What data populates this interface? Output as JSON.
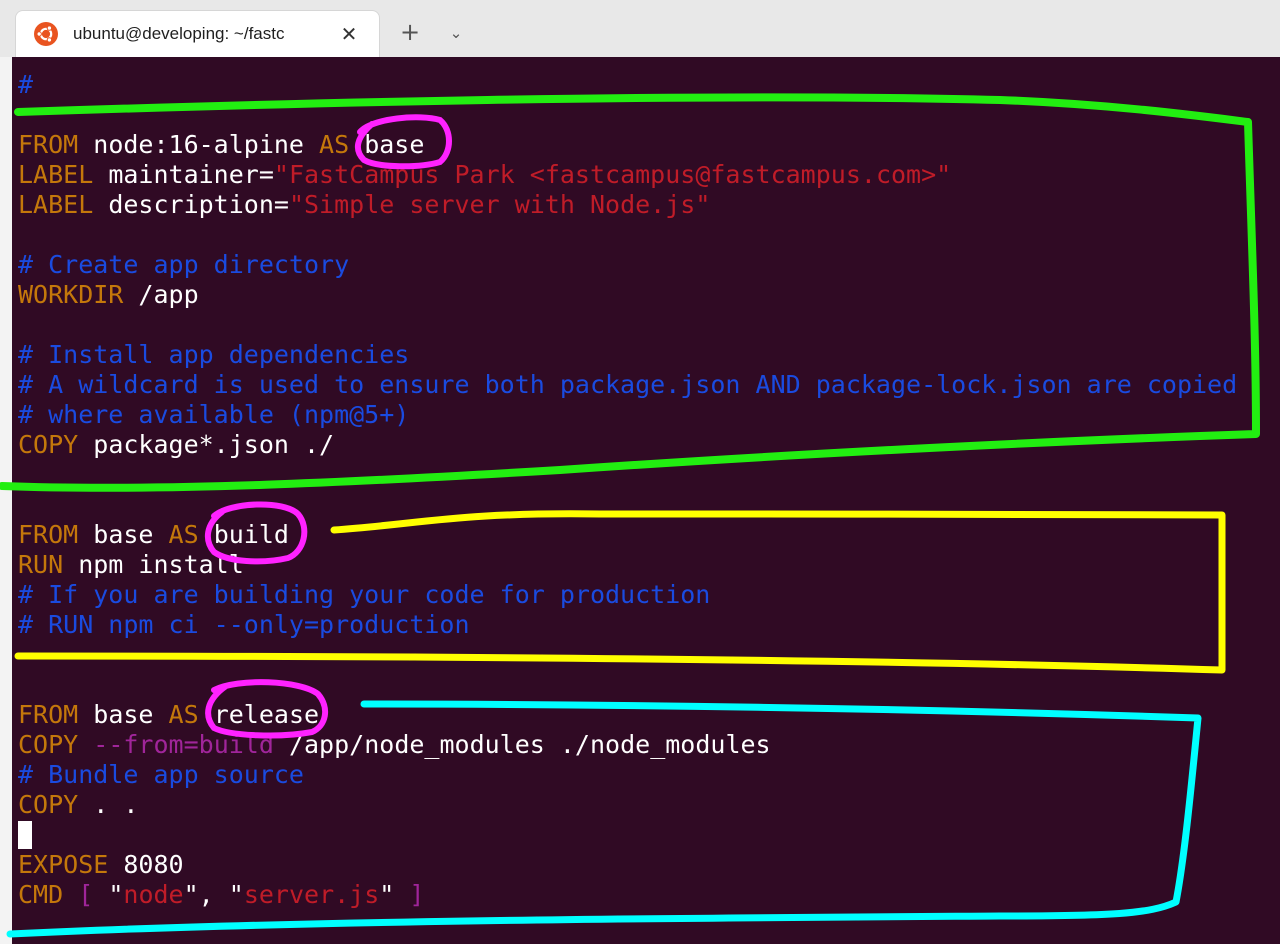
{
  "tab": {
    "title": "ubuntu@developing: ~/fastc",
    "icon": "ubuntu-logo-icon",
    "close_label": "✕",
    "new_tab_label": "+",
    "dropdown_label": "⌄"
  },
  "colors": {
    "terminal_bg": "#300a24",
    "keyword": "#c4780b",
    "string": "#c01c28",
    "comment": "#1a4be0",
    "operator": "#a0259a",
    "text": "#ffffff",
    "annotation_green": "#22ee11",
    "annotation_yellow": "#ffff00",
    "annotation_cyan": "#00ffff",
    "annotation_magenta": "#ff00ff"
  },
  "terminal": {
    "lines": [
      {
        "id": "l00",
        "parts": [
          [
            "cm",
            "#"
          ]
        ]
      },
      {
        "id": "l01",
        "parts": []
      },
      {
        "id": "l02",
        "parts": [
          [
            "kw",
            "FROM"
          ],
          [
            "tx",
            " node:16-alpine "
          ],
          [
            "kw",
            "AS"
          ],
          [
            "tx",
            " base"
          ]
        ]
      },
      {
        "id": "l03",
        "parts": [
          [
            "kw",
            "LABEL"
          ],
          [
            "tx",
            " maintainer="
          ],
          [
            "str",
            "\"FastCampus Park <fastcampus@fastcampus.com>\""
          ]
        ]
      },
      {
        "id": "l04",
        "parts": [
          [
            "kw",
            "LABEL"
          ],
          [
            "tx",
            " description="
          ],
          [
            "str",
            "\"Simple server with Node.js\""
          ]
        ]
      },
      {
        "id": "l05",
        "parts": []
      },
      {
        "id": "l06",
        "parts": [
          [
            "cm",
            "# Create app directory"
          ]
        ]
      },
      {
        "id": "l07",
        "parts": [
          [
            "kw",
            "WORKDIR"
          ],
          [
            "tx",
            " /app"
          ]
        ]
      },
      {
        "id": "l08",
        "parts": []
      },
      {
        "id": "l09",
        "parts": [
          [
            "cm",
            "# Install app dependencies"
          ]
        ]
      },
      {
        "id": "l10",
        "parts": [
          [
            "cm",
            "# A wildcard is used to ensure both package.json AND package-lock.json are copied"
          ]
        ]
      },
      {
        "id": "l11",
        "parts": [
          [
            "cm",
            "# where available (npm@5+)"
          ]
        ]
      },
      {
        "id": "l12",
        "parts": [
          [
            "kw",
            "COPY"
          ],
          [
            "tx",
            " package*.json ./"
          ]
        ]
      },
      {
        "id": "l13",
        "parts": []
      },
      {
        "id": "l14",
        "parts": []
      },
      {
        "id": "l15",
        "parts": [
          [
            "kw",
            "FROM"
          ],
          [
            "tx",
            " base "
          ],
          [
            "kw",
            "AS"
          ],
          [
            "tx",
            " build"
          ]
        ]
      },
      {
        "id": "l16",
        "parts": [
          [
            "kw",
            "RUN"
          ],
          [
            "tx",
            " npm install"
          ]
        ]
      },
      {
        "id": "l17",
        "parts": [
          [
            "cm",
            "# If you are building your code for production"
          ]
        ]
      },
      {
        "id": "l18",
        "parts": [
          [
            "cm",
            "# RUN npm ci --only=production"
          ]
        ]
      },
      {
        "id": "l19",
        "parts": []
      },
      {
        "id": "l20",
        "parts": []
      },
      {
        "id": "l21",
        "parts": [
          [
            "kw",
            "FROM"
          ],
          [
            "tx",
            " base "
          ],
          [
            "kw",
            "AS"
          ],
          [
            "tx",
            " release"
          ]
        ]
      },
      {
        "id": "l22",
        "parts": [
          [
            "kw",
            "COPY"
          ],
          [
            "tx",
            " "
          ],
          [
            "pu",
            "--from=build"
          ],
          [
            "tx",
            " /app/node_modules ./node_modules"
          ]
        ]
      },
      {
        "id": "l23",
        "parts": [
          [
            "cm",
            "# Bundle app source"
          ]
        ]
      },
      {
        "id": "l24",
        "parts": [
          [
            "kw",
            "COPY"
          ],
          [
            "tx",
            " . ."
          ]
        ]
      },
      {
        "id": "l25",
        "parts": [
          [
            "cursor",
            ""
          ]
        ]
      },
      {
        "id": "l26",
        "parts": [
          [
            "kw",
            "EXPOSE"
          ],
          [
            "tx",
            " 8080"
          ]
        ]
      },
      {
        "id": "l27",
        "parts": [
          [
            "kw",
            "CMD"
          ],
          [
            "tx",
            " "
          ],
          [
            "pu",
            "["
          ],
          [
            "tx",
            " \""
          ],
          [
            "str",
            "node"
          ],
          [
            "tx",
            "\", \""
          ],
          [
            "str",
            "server.js"
          ],
          [
            "tx",
            "\" "
          ],
          [
            "pu",
            "]"
          ]
        ]
      }
    ]
  },
  "annotations": [
    {
      "name": "base-stage-outline",
      "color": "green",
      "circled": "base"
    },
    {
      "name": "build-stage-outline",
      "color": "yellow",
      "circled": "build"
    },
    {
      "name": "release-stage-outline",
      "color": "cyan",
      "circled": "release"
    }
  ]
}
